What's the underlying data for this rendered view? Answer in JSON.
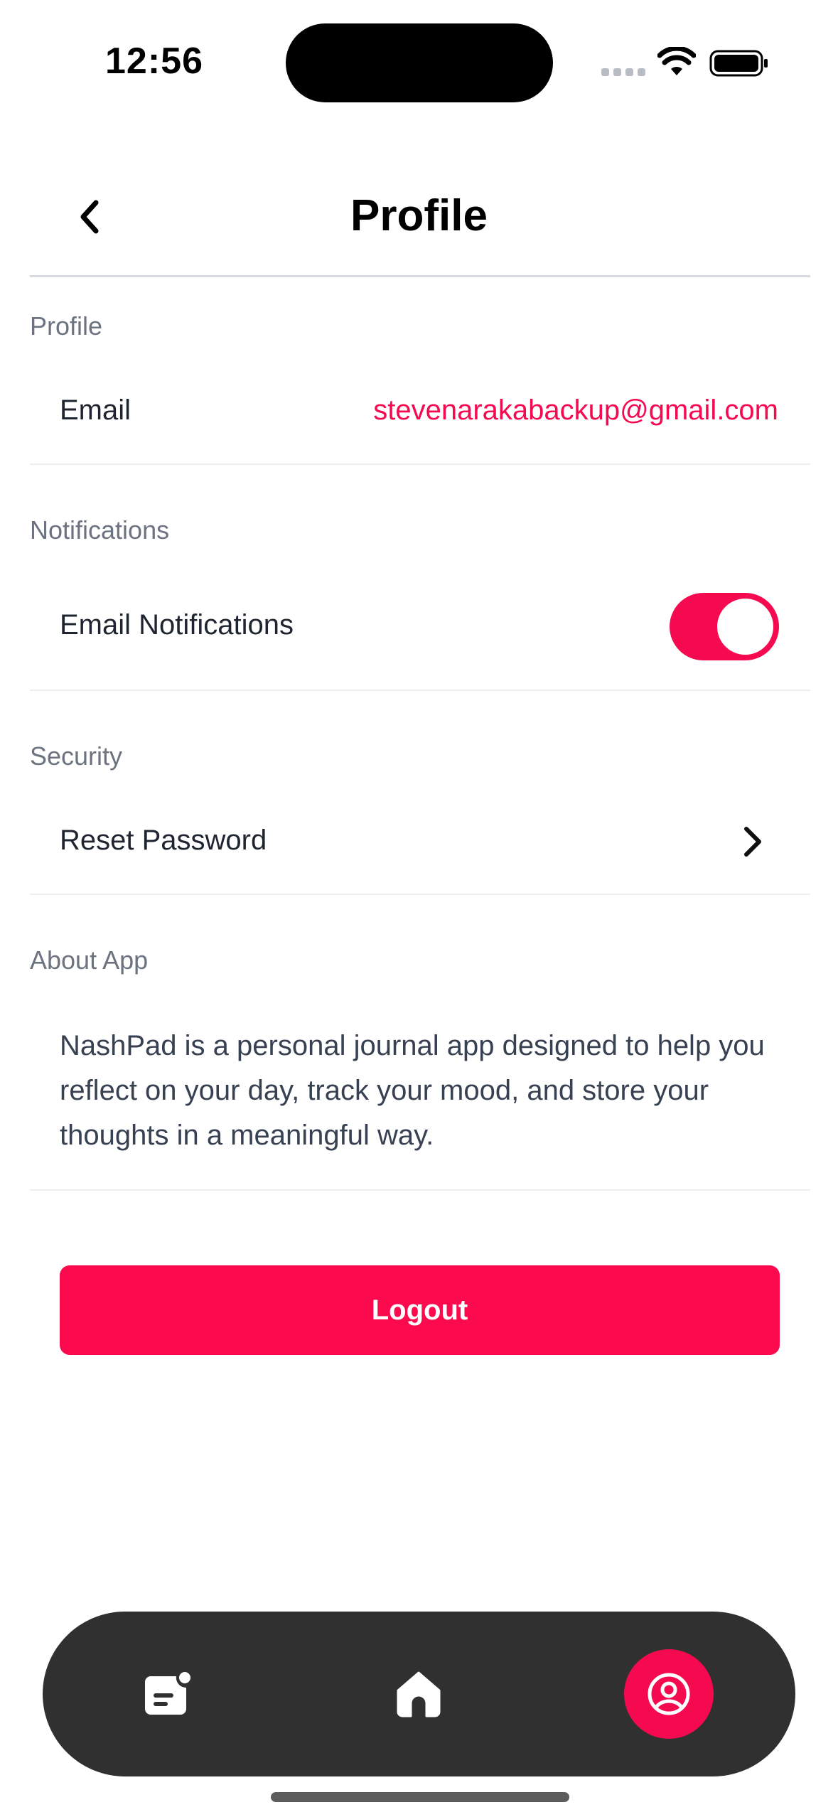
{
  "status_bar": {
    "time": "12:56"
  },
  "header": {
    "title": "Profile"
  },
  "sections": {
    "profile": {
      "label": "Profile",
      "email_label": "Email",
      "email_value": "stevenarakabackup@gmail.com"
    },
    "notifications": {
      "label": "Notifications",
      "email_notifications_label": "Email Notifications",
      "email_notifications_enabled": true
    },
    "security": {
      "label": "Security",
      "reset_password_label": "Reset Password"
    },
    "about": {
      "label": "About App",
      "text": "NashPad is a personal journal app designed to help you reflect on your day, track your mood, and store your thoughts in a meaningful way."
    }
  },
  "logout": {
    "label": "Logout"
  },
  "tab_bar": {
    "tabs": [
      {
        "icon": "journal-icon",
        "active": false
      },
      {
        "icon": "home-icon",
        "active": false
      },
      {
        "icon": "profile-icon",
        "active": true
      }
    ]
  },
  "colors": {
    "accent": "#f50a4f",
    "tab_bar_bg": "#303030"
  }
}
